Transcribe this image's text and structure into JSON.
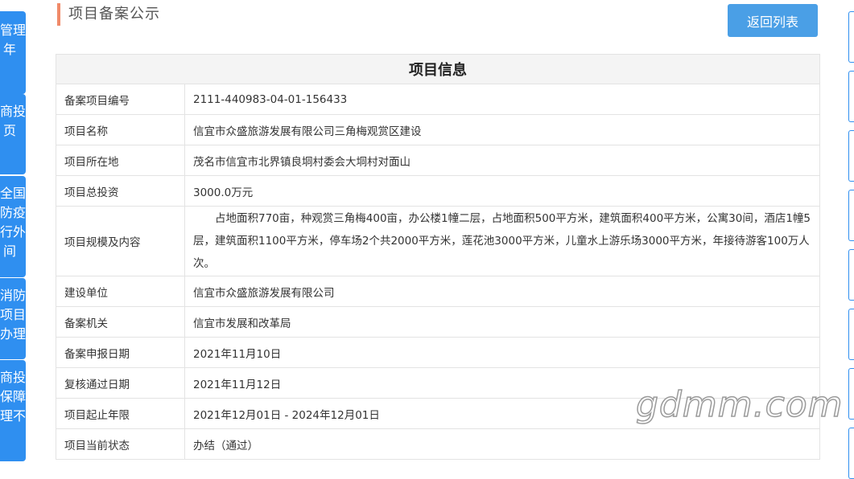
{
  "header": {
    "title": "项目备案公示",
    "back_label": "返回列表"
  },
  "left_nav": [
    {
      "lines": [
        "管理",
        "年"
      ]
    },
    {
      "lines": [
        "商投",
        "页"
      ]
    },
    {
      "lines": [
        "全国",
        "防疫",
        "行外",
        "间"
      ]
    },
    {
      "lines": [
        "消防",
        "项目",
        "办理"
      ]
    },
    {
      "lines": [
        "商投",
        "保障",
        "理不"
      ]
    }
  ],
  "table": {
    "heading": "项目信息",
    "rows": [
      {
        "label": "备案项目编号",
        "value": "2111-440983-04-01-156433"
      },
      {
        "label": "项目名称",
        "value": "信宜市众盛旅游发展有限公司三角梅观赏区建设"
      },
      {
        "label": "项目所在地",
        "value": "茂名市信宜市北界镇良垌村委会大垌村对面山"
      },
      {
        "label": "项目总投资",
        "value": "3000.0万元"
      },
      {
        "label": "项目规模及内容",
        "value": "占地面积770亩，种观赏三角梅400亩，办公楼1幢二层，占地面积500平方米，建筑面积400平方米，公寓30间，酒店1幢5层，建筑面积1100平方米，停车场2个共2000平方米，莲花池3000平方米，儿童水上游乐场3000平方米，年接待游客100万人次。"
      },
      {
        "label": "建设单位",
        "value": "信宜市众盛旅游发展有限公司"
      },
      {
        "label": "备案机关",
        "value": "信宜市发展和改革局"
      },
      {
        "label": "备案申报日期",
        "value": "2021年11月10日"
      },
      {
        "label": "复核通过日期",
        "value": "2021年11月12日"
      },
      {
        "label": "项目起止年限",
        "value": "2021年12月01日 - 2024年12月01日"
      },
      {
        "label": "项目当前状态",
        "value": "办结（通过）"
      }
    ]
  },
  "watermark": "gdmm.com",
  "colors": {
    "accent_blue": "#4a9fe6",
    "sidebar_blue": "#2f8ff0",
    "title_marker": "#f08a69"
  }
}
